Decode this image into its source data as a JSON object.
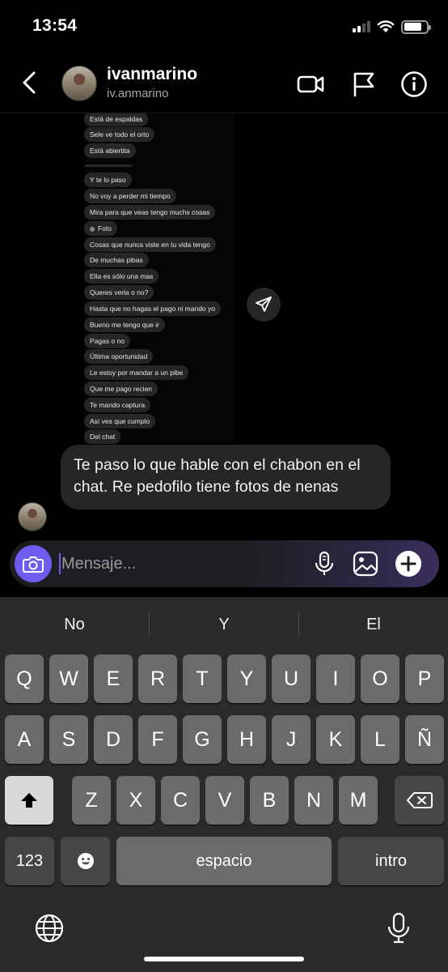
{
  "status_bar": {
    "time": "13:54"
  },
  "header": {
    "name": "ivanmarino",
    "handle": "iv.anmarino"
  },
  "screenshot_messages": [
    "Está de espaldas",
    "Sele ve todo el orto",
    "Está abiertita",
    "Y te lo paso",
    "No voy a perder mi tiempo",
    "Mira para que veas tengo muchs cosas",
    "Foto",
    "Cosas que nunca viste en tu vida tengo",
    "De muchas pibas",
    "Ella es sólo una mas",
    "Queres verla o no?",
    "Hasta que no hagas el pago ni mando yo",
    "Bueno me tengo que ir",
    "Pagas o no",
    "Última oportunidad",
    "Le estoy por mandar a un pibe",
    "Que me pago recien",
    "Te mando captura",
    "Así ves que cumplo",
    "Del chat"
  ],
  "message": {
    "text": "Te paso lo que hable con el chabon en el chat. Re pedofilo tiene fotos de nenas"
  },
  "composer": {
    "placeholder": "Mensaje..."
  },
  "keyboard": {
    "suggestions": [
      "No",
      "Y",
      "El"
    ],
    "row1": [
      "Q",
      "W",
      "E",
      "R",
      "T",
      "Y",
      "U",
      "I",
      "O",
      "P"
    ],
    "row2": [
      "A",
      "S",
      "D",
      "F",
      "G",
      "H",
      "J",
      "K",
      "L",
      "Ñ"
    ],
    "row3": [
      "Z",
      "X",
      "C",
      "V",
      "B",
      "N",
      "M"
    ],
    "numbers_label": "123",
    "space_label": "espacio",
    "return_label": "intro"
  },
  "colors": {
    "accent": "#6d5df0",
    "bubble": "#262626",
    "keyboard_bg": "#2a2a2a",
    "key": "#6b6b6b"
  }
}
